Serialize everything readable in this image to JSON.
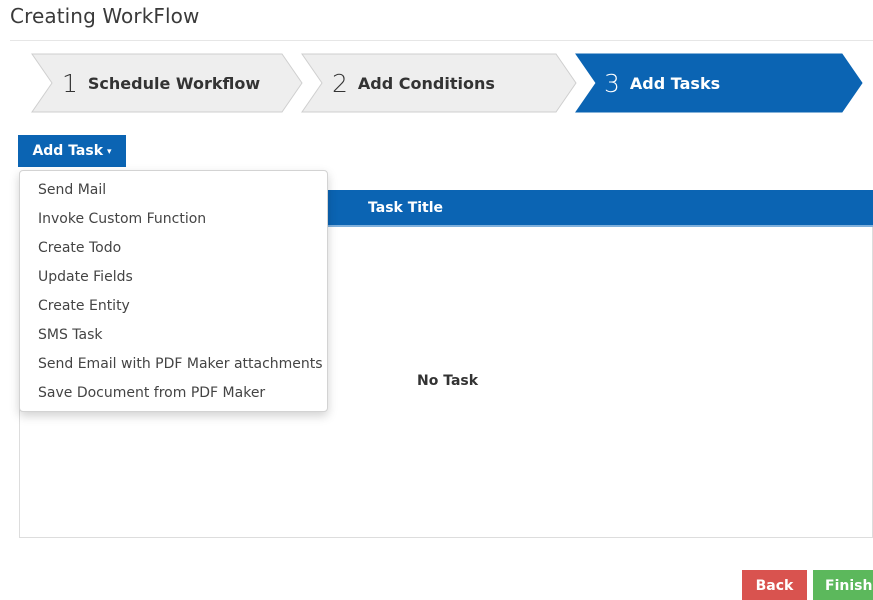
{
  "page": {
    "title": "Creating WorkFlow"
  },
  "wizard": {
    "steps": [
      {
        "number": "1",
        "label": "Schedule Workflow",
        "active": false
      },
      {
        "number": "2",
        "label": "Add Conditions",
        "active": false
      },
      {
        "number": "3",
        "label": "Add Tasks",
        "active": true
      }
    ]
  },
  "add_task": {
    "label": "Add Task",
    "caret": "▾",
    "menu": [
      "Send Mail",
      "Invoke Custom Function",
      "Create Todo",
      "Update Fields",
      "Create Entity",
      "SMS Task",
      "Send Email with PDF Maker attachments",
      "Save Document from PDF Maker"
    ]
  },
  "tasks_table": {
    "header": "Task Title",
    "empty_text": "No Task"
  },
  "footer": {
    "back_label": "Back",
    "finish_label": "Finish"
  },
  "colors": {
    "primary": "#0b64b3",
    "step_inactive": "#eeeeee",
    "back": "#d9534f",
    "finish": "#5cb85c"
  }
}
